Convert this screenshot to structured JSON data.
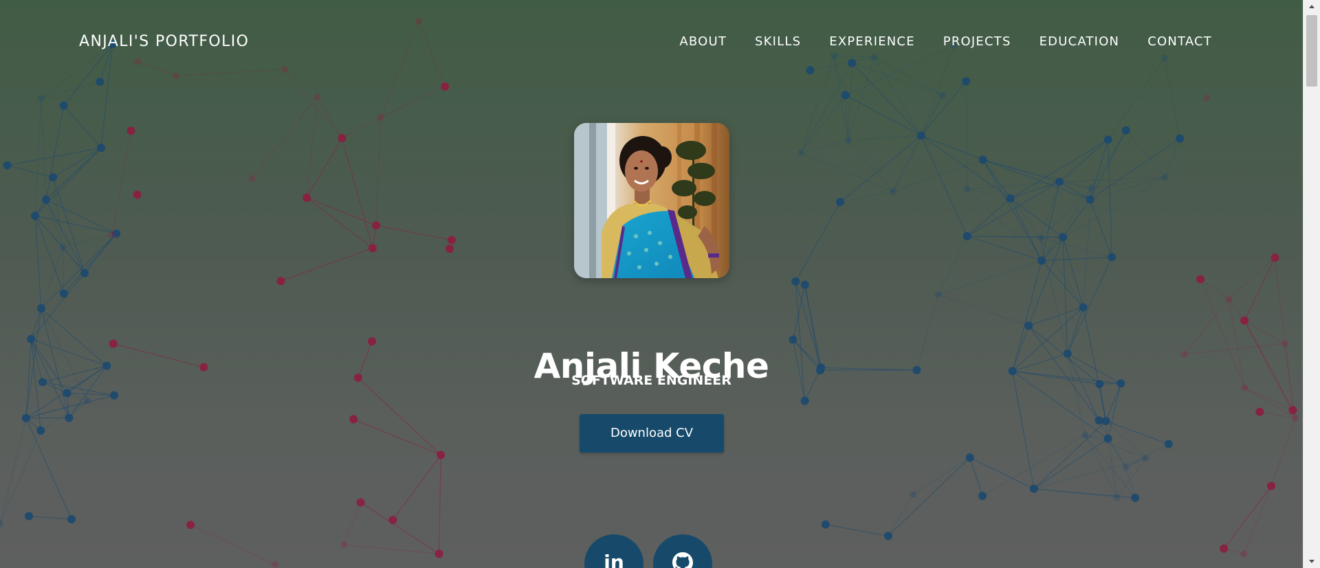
{
  "nav": {
    "brand": "ANJALI'S PORTFOLIO",
    "links": [
      "ABOUT",
      "SKILLS",
      "EXPERIENCE",
      "PROJECTS",
      "EDUCATION",
      "CONTACT"
    ]
  },
  "hero": {
    "name": "Anjali Keche",
    "role": "SOFTWARE ENGINEER",
    "cv_button": "Download CV"
  },
  "social": {
    "linkedin_label": "in"
  },
  "colors": {
    "accent": "#174a6a",
    "text": "#ffffff",
    "network_blue": "#1e4a6e",
    "network_red": "#8a2040"
  },
  "icons": {
    "profile_image": "profile-photo",
    "linkedin": "linkedin-icon",
    "github": "github-icon",
    "scroll_up": "scroll-up-arrow-icon",
    "scroll_down": "scroll-down-arrow-icon"
  }
}
